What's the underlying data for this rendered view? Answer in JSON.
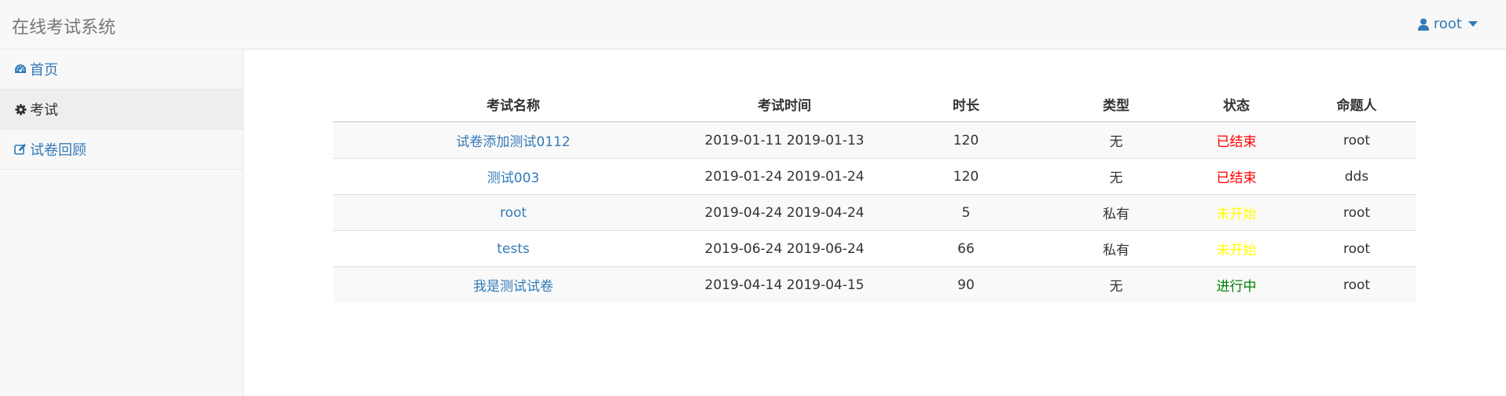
{
  "navbar": {
    "brand": "在线考试系统",
    "user": "root"
  },
  "sidebar": {
    "items": [
      {
        "label": "首页",
        "icon": "dashboard-icon",
        "active": false
      },
      {
        "label": "考试",
        "icon": "gear-icon",
        "active": true
      },
      {
        "label": "试卷回顾",
        "icon": "edit-icon",
        "active": false
      }
    ]
  },
  "table": {
    "headers": [
      "考试名称",
      "考试时间",
      "时长",
      "类型",
      "状态",
      "命题人"
    ],
    "rows": [
      {
        "name": "试卷添加测试0112",
        "time": "2019-01-11 2019-01-13",
        "duration": "120",
        "type": "无",
        "status": "已结束",
        "status_color": "#ff0000",
        "author": "root"
      },
      {
        "name": "测试003",
        "time": "2019-01-24 2019-01-24",
        "duration": "120",
        "type": "无",
        "status": "已结束",
        "status_color": "#ff0000",
        "author": "dds"
      },
      {
        "name": "root",
        "time": "2019-04-24 2019-04-24",
        "duration": "5",
        "type": "私有",
        "status": "未开始",
        "status_color": "#ffff00",
        "author": "root"
      },
      {
        "name": "tests",
        "time": "2019-06-24 2019-06-24",
        "duration": "66",
        "type": "私有",
        "status": "未开始",
        "status_color": "#ffff00",
        "author": "root"
      },
      {
        "name": "我是测试试卷",
        "time": "2019-04-14 2019-04-15",
        "duration": "90",
        "type": "无",
        "status": "进行中",
        "status_color": "#008000",
        "author": "root"
      }
    ]
  },
  "colors": {
    "link": "#337ab7",
    "navbar_bg": "#f8f8f8",
    "ended": "#ff0000",
    "pending": "#ffff00",
    "running": "#008000"
  }
}
